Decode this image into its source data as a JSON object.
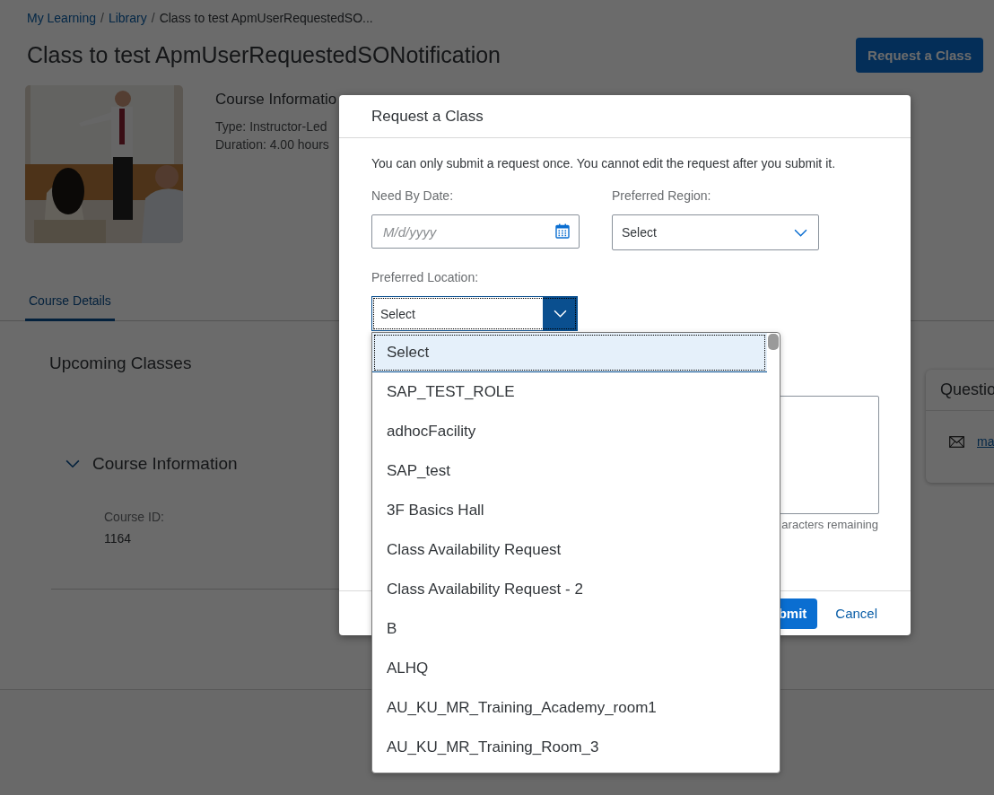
{
  "breadcrumb": {
    "separator": "/",
    "items": [
      {
        "label": "My Learning",
        "kind": "link"
      },
      {
        "label": "Library",
        "kind": "link"
      },
      {
        "label": "Class to test ApmUserRequestedSO...",
        "kind": "current"
      }
    ]
  },
  "page_title": "Class to test ApmUserRequestedSONotification",
  "request_button": "Request a Class",
  "summary": {
    "heading": "Course Informatio",
    "lines": [
      "Type: Instructor-Led",
      "Duration: 4.00 hours"
    ]
  },
  "tabs": [
    {
      "label": "Course Details",
      "selected": true
    }
  ],
  "upcoming_heading": "Upcoming Classes",
  "section": {
    "title": "Course Information",
    "expanded": true,
    "fields": [
      {
        "label": "Course ID:",
        "value": "1164"
      }
    ]
  },
  "questions_card": {
    "title": "Questio",
    "link": "ma"
  },
  "dialog": {
    "title": "Request a Class",
    "notice": "You can only submit a request once. You cannot edit the request after you submit it.",
    "need_by_date": {
      "label": "Need By Date:",
      "placeholder": "M/d/yyyy"
    },
    "preferred_region": {
      "label": "Preferred Region:",
      "value": "Select"
    },
    "preferred_location": {
      "label": "Preferred Location:",
      "value": "Select",
      "expanded": true,
      "options": [
        {
          "label": "Select",
          "selected": true
        },
        {
          "label": "SAP_TEST_ROLE",
          "selected": false
        },
        {
          "label": "adhocFacility",
          "selected": false
        },
        {
          "label": "SAP_test",
          "selected": false
        },
        {
          "label": "3F Basics Hall",
          "selected": false
        },
        {
          "label": "Class Availability Request",
          "selected": false
        },
        {
          "label": "Class Availability Request - 2",
          "selected": false
        },
        {
          "label": "B",
          "selected": false
        },
        {
          "label": "ALHQ",
          "selected": false
        },
        {
          "label": "AU_KU_MR_Training_Academy_room1",
          "selected": false
        },
        {
          "label": "AU_KU_MR_Training_Room_3",
          "selected": false
        }
      ]
    },
    "char_count": "aracters remaining",
    "buttons": [
      {
        "label": "bmit",
        "kind": "primary"
      },
      {
        "label": "Cancel",
        "kind": "secondary"
      }
    ]
  }
}
